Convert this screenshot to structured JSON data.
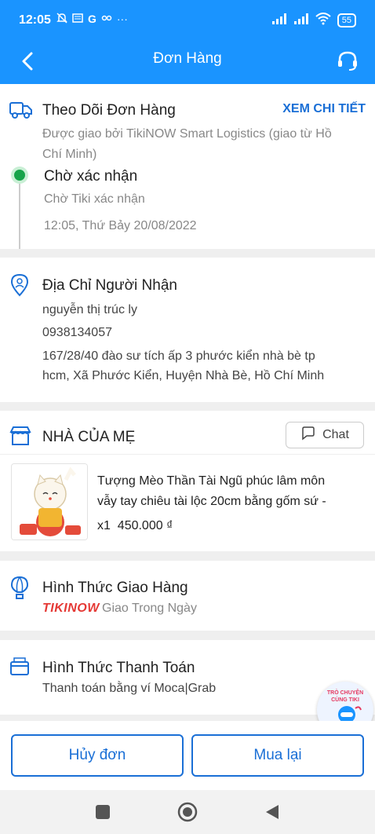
{
  "status_bar": {
    "time": "12:05",
    "battery": "55",
    "left_icons": [
      "mute-icon",
      "news-icon",
      "g-icon",
      "link-icon",
      "more-dots-icon"
    ],
    "right_icons": [
      "signal-icon",
      "signal-icon",
      "wifi-icon",
      "battery-icon"
    ]
  },
  "app_bar": {
    "title": "Đơn Hàng"
  },
  "tracking": {
    "title": "Theo Dõi Đơn Hàng",
    "link": "XEM CHI TIẾT",
    "carrier_line1": "Được giao bởi TikiNOW Smart Logistics (giao từ Hồ",
    "carrier_line2": "Chí Minh)",
    "status": "Chờ xác nhận",
    "status_desc": "Chờ Tiki xác nhận",
    "timestamp": "12:05, Thứ Bảy 20/08/2022",
    "status_color": "#17a34a"
  },
  "address": {
    "title": "Địa Chỉ Người Nhận",
    "name": "nguyễn thị trúc ly",
    "phone": "0938134057",
    "line1": "167/28/40 đào sư tích ấp 3 phước kiển nhà bè tp",
    "line2": "hcm, Xã Phước Kiển, Huyện Nhà Bè, Hồ Chí Minh"
  },
  "shop": {
    "name": "NHÀ CỦA MẸ",
    "chat_label": "Chat",
    "product": {
      "title_line1": "Tượng Mèo Thần Tài Ngũ phúc lâm môn",
      "title_line2": "vẫy tay chiêu tài lộc 20cm bằng gốm sứ -",
      "qty_price": "x1  450.000 ₫"
    }
  },
  "delivery": {
    "title": "Hình Thức Giao Hàng",
    "brand": "TIKINOW",
    "desc": "Giao Trong Ngày"
  },
  "payment": {
    "title": "Hình Thức Thanh Toán",
    "desc": "Thanh toán bằng ví Moca|Grab"
  },
  "actions": {
    "cancel": "Hủy đơn",
    "rebuy": "Mua lại"
  },
  "fab": {
    "label": "TRÒ CHUYỆN CÙNG TIKI"
  },
  "colors": {
    "primary": "#1a94ff",
    "link": "#1a6fd6"
  }
}
